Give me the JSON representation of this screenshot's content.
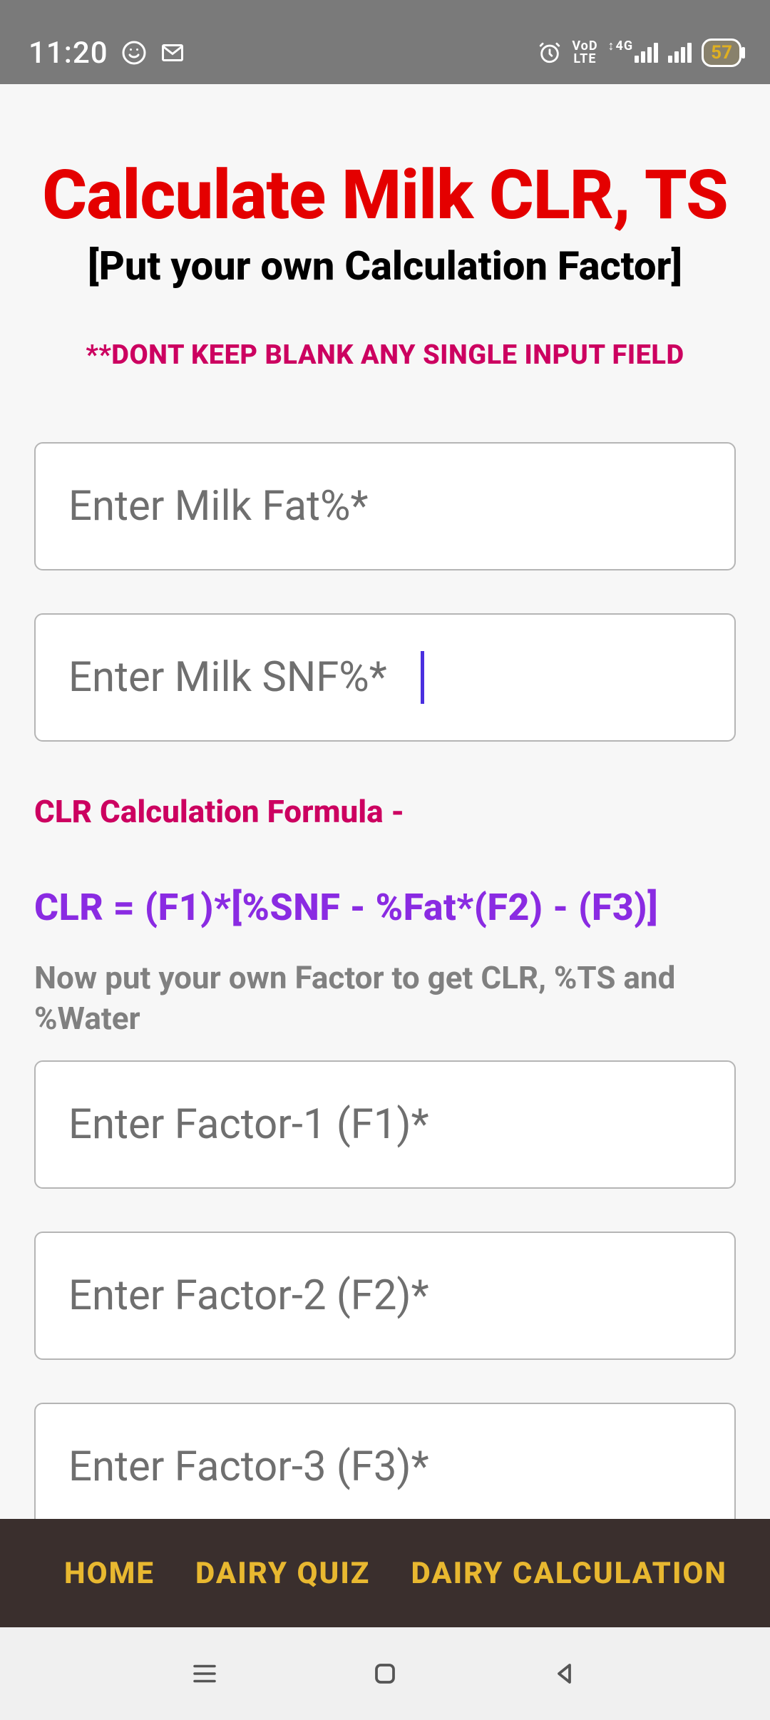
{
  "statusbar": {
    "time": "11:20",
    "battery": "57",
    "vod": "VoD",
    "lte": "LTE",
    "net": "4G"
  },
  "main": {
    "title": "Calculate Milk CLR, TS",
    "subtitle": "[Put your own Calculation Factor]",
    "warning": "**DONT KEEP BLANK ANY SINGLE INPUT FIELD",
    "input_fat_placeholder": "Enter Milk Fat%*",
    "input_snf_placeholder": "Enter Milk SNF%*",
    "formula_label": "CLR Calculation Formula -",
    "formula": "CLR = (F1)*[%SNF - %Fat*(F2) - (F3)]",
    "instruction": "Now put your own Factor to get CLR, %TS and %Water",
    "input_f1_placeholder": "Enter Factor-1 (F1)*",
    "input_f2_placeholder": "Enter Factor-2 (F2)*",
    "input_f3_placeholder": "Enter Factor-3 (F3)*"
  },
  "nav": {
    "home": "HOME",
    "quiz": "DAIRY QUIZ",
    "calc": "DAIRY CALCULATION"
  }
}
